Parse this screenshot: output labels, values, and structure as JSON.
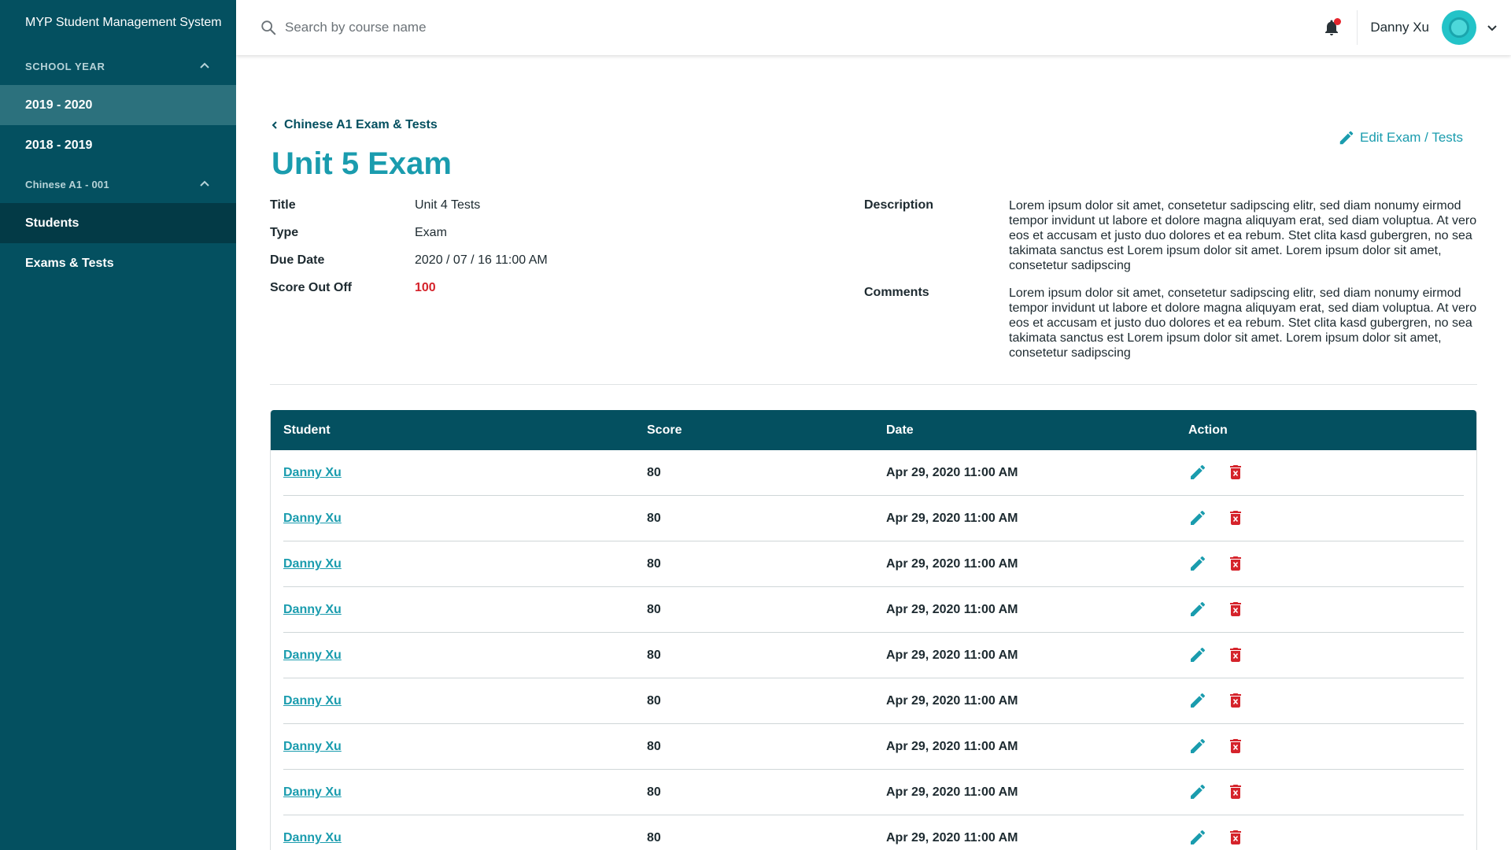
{
  "sidebar": {
    "app_title": "MYP Student Management System",
    "school_year_header": "SCHOOL YEAR",
    "years": [
      {
        "label": "2019 - 2020"
      },
      {
        "label": "2018 - 2019"
      }
    ],
    "course_header": "Chinese A1 - 001",
    "course_items": [
      {
        "label": "Students"
      },
      {
        "label": "Exams & Tests"
      }
    ]
  },
  "topbar": {
    "search_placeholder": "Search by course name",
    "username": "Danny Xu"
  },
  "main": {
    "breadcrumb": "Chinese A1 Exam & Tests",
    "title": "Unit 5 Exam",
    "edit_label": "Edit Exam / Tests",
    "fields": {
      "title_key": "Title",
      "title_value": "Unit 4 Tests",
      "type_key": "Type",
      "type_value": "Exam",
      "due_key": "Due Date",
      "due_value": "2020 / 07 / 16 11:00 AM",
      "score_key": "Score Out Off",
      "score_value": "100",
      "description_key": "Description",
      "description_value": "Lorem ipsum dolor sit amet, consetetur sadipscing elitr, sed diam nonumy eirmod tempor invidunt ut labore et dolore magna aliquyam erat, sed diam voluptua. At vero eos et accusam et justo duo dolores et ea rebum. Stet clita kasd gubergren, no sea takimata sanctus est Lorem ipsum dolor sit amet. Lorem ipsum dolor sit amet, consetetur sadipscing",
      "comments_key": "Comments",
      "comments_value": "Lorem ipsum dolor sit amet, consetetur sadipscing elitr, sed diam nonumy eirmod tempor invidunt ut labore et dolore magna aliquyam erat, sed diam voluptua. At vero eos et accusam et justo duo dolores et ea rebum. Stet clita kasd gubergren, no sea takimata sanctus est Lorem ipsum dolor sit amet. Lorem ipsum dolor sit amet, consetetur sadipscing"
    }
  },
  "table": {
    "headers": {
      "student": "Student",
      "score": "Score",
      "date": "Date",
      "action": "Action"
    },
    "rows": [
      {
        "student": "Danny Xu",
        "score": "80",
        "date": "Apr 29, 2020 11:00 AM"
      },
      {
        "student": "Danny Xu",
        "score": "80",
        "date": "Apr 29, 2020 11:00 AM"
      },
      {
        "student": "Danny Xu",
        "score": "80",
        "date": "Apr 29, 2020 11:00 AM"
      },
      {
        "student": "Danny Xu",
        "score": "80",
        "date": "Apr 29, 2020 11:00 AM"
      },
      {
        "student": "Danny Xu",
        "score": "80",
        "date": "Apr 29, 2020 11:00 AM"
      },
      {
        "student": "Danny Xu",
        "score": "80",
        "date": "Apr 29, 2020 11:00 AM"
      },
      {
        "student": "Danny Xu",
        "score": "80",
        "date": "Apr 29, 2020 11:00 AM"
      },
      {
        "student": "Danny Xu",
        "score": "80",
        "date": "Apr 29, 2020 11:00 AM"
      },
      {
        "student": "Danny Xu",
        "score": "80",
        "date": "Apr 29, 2020 11:00 AM"
      }
    ]
  },
  "colors": {
    "sidebar_bg": "#045060",
    "sidebar_active_year": "#2c717d",
    "sidebar_active_item": "#033a46",
    "accent": "#1a9cae",
    "danger": "#d5232b",
    "table_header": "#045060"
  },
  "icons": {
    "search": "search-icon",
    "bell": "bell-icon",
    "chevron_up": "chevron-up-icon",
    "chevron_down": "chevron-down-icon",
    "chevron_left": "chevron-left-icon",
    "edit": "pencil-icon",
    "delete": "trash-icon",
    "avatar": "avatar-icon"
  }
}
